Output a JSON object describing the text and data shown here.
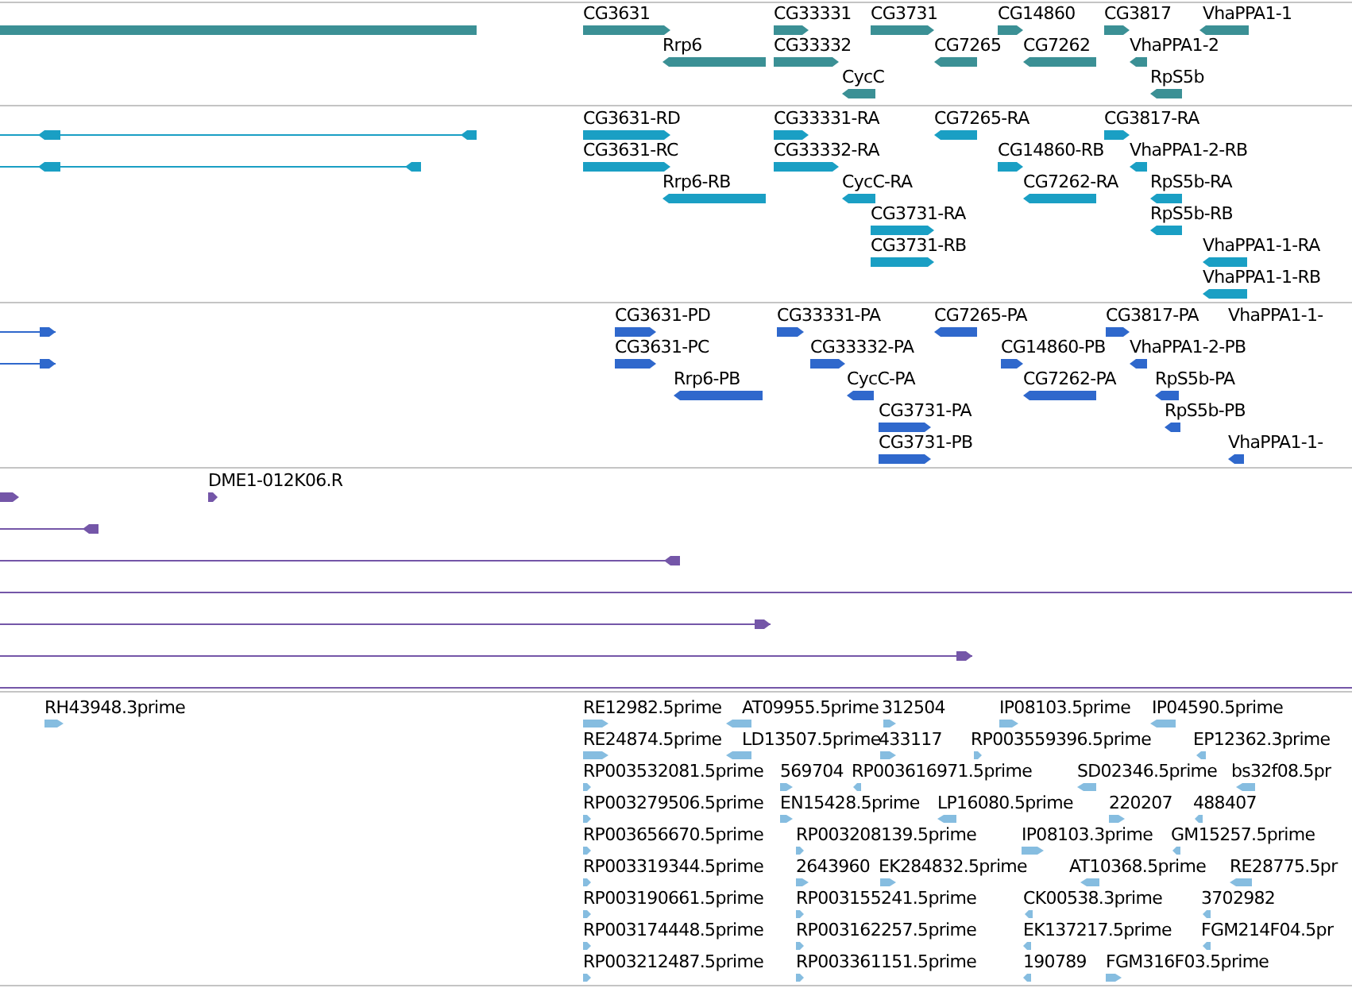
{
  "tracks": [
    {
      "kind": "gene",
      "color": "#3b9095",
      "features": [
        {
          "kind": "block"
        },
        {
          "kind": "block",
          "label": "CG3631",
          "reverse": false
        },
        {
          "kind": "block",
          "label": "CG33331",
          "reverse": false
        },
        {
          "kind": "block",
          "label": "CG3731",
          "reverse": false
        },
        {
          "kind": "block",
          "label": "CG14860",
          "reverse": false
        },
        {
          "kind": "block",
          "label": "CG3817",
          "reverse": false
        },
        {
          "kind": "block",
          "label": "VhaPPA1-1",
          "reverse": true
        },
        {
          "kind": "block",
          "label": "Rrp6",
          "reverse": true
        },
        {
          "kind": "block",
          "label": "CG33332",
          "reverse": false
        },
        {
          "kind": "block",
          "label": "CG7265",
          "reverse": true
        },
        {
          "kind": "block",
          "label": "CG7262",
          "reverse": true
        },
        {
          "kind": "block",
          "label": "VhaPPA1-2",
          "reverse": true
        },
        {
          "kind": "block",
          "label": "CycC",
          "reverse": true
        },
        {
          "kind": "block",
          "label": "RpS5b",
          "reverse": true
        }
      ]
    },
    {
      "kind": "transcript",
      "color": "#1a9fc4",
      "features": [
        {
          "kind": "line",
          "reverse": true
        },
        {
          "kind": "line",
          "reverse": true
        },
        {
          "kind": "block",
          "label": "CG3631-RD",
          "reverse": false
        },
        {
          "kind": "block",
          "label": "CG33331-RA",
          "reverse": false
        },
        {
          "kind": "block",
          "label": "CG7265-RA",
          "reverse": true
        },
        {
          "kind": "block",
          "label": "CG3817-RA",
          "reverse": false
        },
        {
          "kind": "block",
          "label": "CG3631-RC",
          "reverse": false
        },
        {
          "kind": "block",
          "label": "CG33332-RA",
          "reverse": false
        },
        {
          "kind": "block",
          "label": "CG14860-RB",
          "reverse": false
        },
        {
          "kind": "block",
          "label": "VhaPPA1-2-RB",
          "reverse": true
        },
        {
          "kind": "block",
          "label": "Rrp6-RB",
          "reverse": true
        },
        {
          "kind": "block",
          "label": "CycC-RA",
          "reverse": true
        },
        {
          "kind": "block",
          "label": "CG7262-RA",
          "reverse": true
        },
        {
          "kind": "block",
          "label": "RpS5b-RA",
          "reverse": true
        },
        {
          "kind": "block",
          "label": "CG3731-RA",
          "reverse": false
        },
        {
          "kind": "block",
          "label": "RpS5b-RB",
          "reverse": true
        },
        {
          "kind": "block",
          "label": "CG3731-RB",
          "reverse": false
        },
        {
          "kind": "block",
          "label": "VhaPPA1-1-RA",
          "reverse": true
        },
        {
          "kind": "block",
          "label": "VhaPPA1-1-RB",
          "reverse": true
        }
      ]
    },
    {
      "kind": "protein",
      "color": "#2f68cc",
      "features": [
        {
          "kind": "line",
          "reverse": false
        },
        {
          "kind": "line",
          "reverse": false
        },
        {
          "kind": "block",
          "label": "CG3631-PD",
          "reverse": false
        },
        {
          "kind": "block",
          "label": "CG33331-PA",
          "reverse": false
        },
        {
          "kind": "block",
          "label": "CG7265-PA",
          "reverse": true
        },
        {
          "kind": "block",
          "label": "CG3817-PA",
          "reverse": false
        },
        {
          "kind": "text",
          "label": "VhaPPA1-1-"
        },
        {
          "kind": "block",
          "label": "CG3631-PC",
          "reverse": false
        },
        {
          "kind": "block",
          "label": "CG33332-PA",
          "reverse": false
        },
        {
          "kind": "block",
          "label": "CG14860-PB",
          "reverse": false
        },
        {
          "kind": "block",
          "label": "VhaPPA1-2-PB",
          "reverse": true
        },
        {
          "kind": "block",
          "label": "Rrp6-PB",
          "reverse": true
        },
        {
          "kind": "block",
          "label": "CycC-PA",
          "reverse": true
        },
        {
          "kind": "block",
          "label": "CG7262-PA",
          "reverse": true
        },
        {
          "kind": "block",
          "label": "RpS5b-PA",
          "reverse": true
        },
        {
          "kind": "block",
          "label": "CG3731-PA",
          "reverse": false
        },
        {
          "kind": "block",
          "label": "RpS5b-PB",
          "reverse": true
        },
        {
          "kind": "block",
          "label": "CG3731-PB",
          "reverse": false
        },
        {
          "kind": "block",
          "label": "VhaPPA1-1-",
          "reverse": true
        }
      ]
    },
    {
      "kind": "alignment",
      "color": "#7456a8",
      "features": [
        {
          "kind": "block",
          "reverse": false
        },
        {
          "kind": "block",
          "label": "DME1-012K06.R",
          "reverse": false
        },
        {
          "kind": "line",
          "reverse": true
        },
        {
          "kind": "line",
          "reverse": true
        },
        {
          "kind": "line"
        },
        {
          "kind": "line",
          "reverse": false
        },
        {
          "kind": "line",
          "reverse": false
        },
        {
          "kind": "line"
        }
      ]
    },
    {
      "kind": "est",
      "color": "#86bde0",
      "features": [
        {
          "kind": "block",
          "label": "RH43948.3prime",
          "reverse": false
        },
        {
          "kind": "block",
          "label": "RE12982.5prime",
          "reverse": false
        },
        {
          "kind": "block",
          "label": "AT09955.5prime",
          "reverse": true
        },
        {
          "kind": "block",
          "label": "312504",
          "reverse": false
        },
        {
          "kind": "block",
          "label": "IP08103.5prime",
          "reverse": false
        },
        {
          "kind": "block",
          "label": "IP04590.5prime",
          "reverse": true
        },
        {
          "kind": "block",
          "label": "RE24874.5prime",
          "reverse": false
        },
        {
          "kind": "block",
          "label": "LD13507.5prime",
          "reverse": true
        },
        {
          "kind": "block",
          "label": "433117",
          "reverse": false
        },
        {
          "kind": "block",
          "label": "RP003559396.5prime",
          "reverse": false
        },
        {
          "kind": "block",
          "label": "EP12362.3prime",
          "reverse": true
        },
        {
          "kind": "block",
          "label": "RP003532081.5prime",
          "reverse": false
        },
        {
          "kind": "block",
          "label": "569704",
          "reverse": false
        },
        {
          "kind": "block",
          "label": "RP003616971.5prime",
          "reverse": true
        },
        {
          "kind": "block",
          "label": "SD02346.5prime",
          "reverse": true
        },
        {
          "kind": "block",
          "label": "bs32f08.5pr",
          "reverse": true
        },
        {
          "kind": "block",
          "label": "RP003279506.5prime",
          "reverse": false
        },
        {
          "kind": "block",
          "label": "EN15428.5prime",
          "reverse": false
        },
        {
          "kind": "block",
          "label": "LP16080.5prime",
          "reverse": true
        },
        {
          "kind": "block",
          "label": "220207",
          "reverse": false
        },
        {
          "kind": "block",
          "label": "488407",
          "reverse": true
        },
        {
          "kind": "block",
          "label": "RP003656670.5prime",
          "reverse": false
        },
        {
          "kind": "block",
          "label": "RP003208139.5prime",
          "reverse": false
        },
        {
          "kind": "block",
          "label": "IP08103.3prime",
          "reverse": false
        },
        {
          "kind": "block",
          "label": "GM15257.5prime",
          "reverse": true
        },
        {
          "kind": "block",
          "label": "RP003319344.5prime",
          "reverse": false
        },
        {
          "kind": "block",
          "label": "2643960",
          "reverse": false
        },
        {
          "kind": "block",
          "label": "EK284832.5prime",
          "reverse": false
        },
        {
          "kind": "block",
          "label": "AT10368.5prime",
          "reverse": true
        },
        {
          "kind": "block",
          "label": "RE28775.5pr",
          "reverse": true
        },
        {
          "kind": "block",
          "label": "RP003190661.5prime",
          "reverse": false
        },
        {
          "kind": "block",
          "label": "RP003155241.5prime",
          "reverse": false
        },
        {
          "kind": "block",
          "label": "CK00538.3prime",
          "reverse": true
        },
        {
          "kind": "block",
          "label": "3702982",
          "reverse": true
        },
        {
          "kind": "block",
          "label": "RP003174448.5prime",
          "reverse": false
        },
        {
          "kind": "block",
          "label": "RP003162257.5prime",
          "reverse": false
        },
        {
          "kind": "block",
          "label": "EK137217.5prime",
          "reverse": true
        },
        {
          "kind": "block",
          "label": "FGM214F04.5pr",
          "reverse": true
        },
        {
          "kind": "block",
          "label": "RP003212487.5prime",
          "reverse": false
        },
        {
          "kind": "block",
          "label": "RP003361151.5prime",
          "reverse": false
        },
        {
          "kind": "block",
          "label": "190789",
          "reverse": true
        },
        {
          "kind": "block",
          "label": "FGM316F03.5prime",
          "reverse": false
        }
      ]
    }
  ]
}
